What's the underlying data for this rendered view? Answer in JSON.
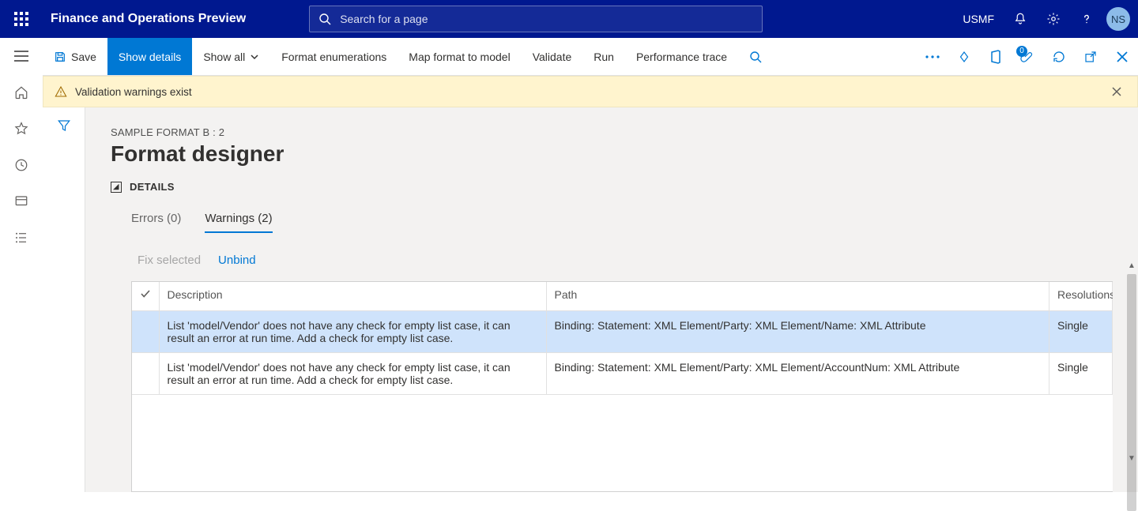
{
  "header": {
    "app_title": "Finance and Operations Preview",
    "search_placeholder": "Search for a page",
    "entity": "USMF",
    "avatar_initials": "NS"
  },
  "actionbar": {
    "save": "Save",
    "show_details": "Show details",
    "show_all": "Show all",
    "format_enumerations": "Format enumerations",
    "map_format": "Map format to model",
    "validate": "Validate",
    "run": "Run",
    "performance_trace": "Performance trace",
    "attachments_badge": "0"
  },
  "banner": {
    "message": "Validation warnings exist"
  },
  "page": {
    "crumb": "SAMPLE FORMAT B : 2",
    "title": "Format designer",
    "details_label": "DETAILS"
  },
  "tabs": {
    "errors": "Errors (0)",
    "warnings": "Warnings (2)"
  },
  "sub_actions": {
    "fix_selected": "Fix selected",
    "unbind": "Unbind"
  },
  "grid": {
    "headers": {
      "description": "Description",
      "path": "Path",
      "resolutions": "Resolutions"
    },
    "rows": [
      {
        "selected": true,
        "description": "List 'model/Vendor' does not have any check for empty list case, it can result an error at run time. Add a check for empty list case.",
        "path": "Binding: Statement: XML Element/Party: XML Element/Name: XML Attribute",
        "resolutions": "Single"
      },
      {
        "selected": false,
        "description": "List 'model/Vendor' does not have any check for empty list case, it can result an error at run time. Add a check for empty list case.",
        "path": "Binding: Statement: XML Element/Party: XML Element/AccountNum: XML Attribute",
        "resolutions": "Single"
      }
    ]
  }
}
